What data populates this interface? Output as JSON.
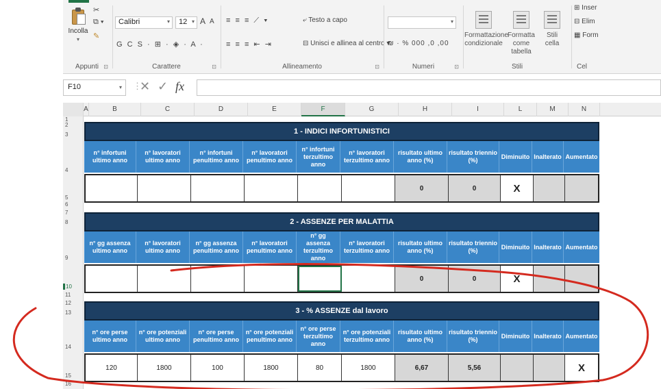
{
  "ribbon": {
    "clipboard": {
      "paste_label": "Incolla",
      "group_label": "Appunti",
      "cut_icon": "scissors-icon",
      "copy_icon": "copy-icon",
      "format_painter_icon": "brush-icon"
    },
    "font": {
      "font_name": "Calibri",
      "font_size": "12",
      "grow_label": "A",
      "shrink_label": "A",
      "format_row": "G  C  S  ·  ⊞  ·  ◈  ·  A  ·",
      "group_label": "Carattere"
    },
    "alignment": {
      "wrap_text_label": "Testo a capo",
      "merge_center_label": "Unisci e allinea al centro",
      "align_row": "≡ ≡ ≡   ⇤ ⇥",
      "group_label": "Allineamento"
    },
    "number": {
      "format_row": "₪ ·  %  000   ,0  ,00",
      "group_label": "Numeri"
    },
    "styles": {
      "conditional_label": "Formattazione condizionale",
      "table_label": "Formatta come tabella",
      "cell_label": "Stili cella",
      "group_label": "Stili"
    },
    "cells": {
      "insert_label": "Inser",
      "delete_label": "Elim",
      "format_label": "Form",
      "group_label": "Cel"
    }
  },
  "formula_bar": {
    "name_box": "F10",
    "cancel_icon": "✕",
    "confirm_icon": "✓",
    "fx_label": "fx",
    "value": ""
  },
  "columns": [
    "A",
    "B",
    "C",
    "D",
    "E",
    "F",
    "G",
    "H",
    "I",
    "L",
    "M",
    "N"
  ],
  "rows": [
    "1",
    "2",
    "3",
    "4",
    "5",
    "6",
    "7",
    "8",
    "9",
    "10",
    "11",
    "12",
    "13",
    "14",
    "15",
    "16"
  ],
  "tables": [
    {
      "title": "1 - INDICI INFORTUNISTICI",
      "headers": [
        "n° infortuni ultimo anno",
        "n° lavoratori ultimo anno",
        "n° infortuni penultimo anno",
        "n° lavoratori penultimo anno",
        "n° infortuni terzultimo anno",
        "n° lavoratori terzultimo anno",
        "risultato ultimo anno (%)",
        "risultato triennio (%)",
        "Diminuito",
        "Inalterato",
        "Aumentato"
      ],
      "values": [
        "",
        "",
        "",
        "",
        "",
        "",
        "0",
        "0",
        "X",
        "",
        ""
      ]
    },
    {
      "title": "2 - ASSENZE PER MALATTIA",
      "headers": [
        "n° gg assenza ultimo anno",
        "n° lavoratori ultimo anno",
        "n° gg assenza penultimo anno",
        "n° lavoratori penultimo anno",
        "n° gg assenza terzultimo anno",
        "n° lavoratori terzultimo anno",
        "risultato ultimo anno (%)",
        "risultato triennio (%)",
        "Diminuito",
        "Inalterato",
        "Aumentato"
      ],
      "values": [
        "",
        "",
        "",
        "",
        "",
        "",
        "0",
        "0",
        "X",
        "",
        ""
      ]
    },
    {
      "title": "3 - % ASSENZE dal lavoro",
      "headers": [
        "n° ore perse ultimo anno",
        "n° ore potenziali ultimo anno",
        "n° ore perse penultimo anno",
        "n° ore potenziali penultimo anno",
        "n° ore perse terzultimo anno",
        "n° ore potenziali terzultimo anno",
        "risultato ultimo anno (%)",
        "risultato triennio (%)",
        "Diminuito",
        "Inalterato",
        "Aumentato"
      ],
      "values": [
        "120",
        "1800",
        "100",
        "1800",
        "80",
        "1800",
        "6,67",
        "5,56",
        "",
        "",
        "X"
      ]
    }
  ],
  "colors": {
    "title_bar": "#1d3f63",
    "header_row": "#3a86c8",
    "result_cell": "#d7d7d7",
    "annotation": "#d42a1f",
    "selection": "#217346"
  }
}
